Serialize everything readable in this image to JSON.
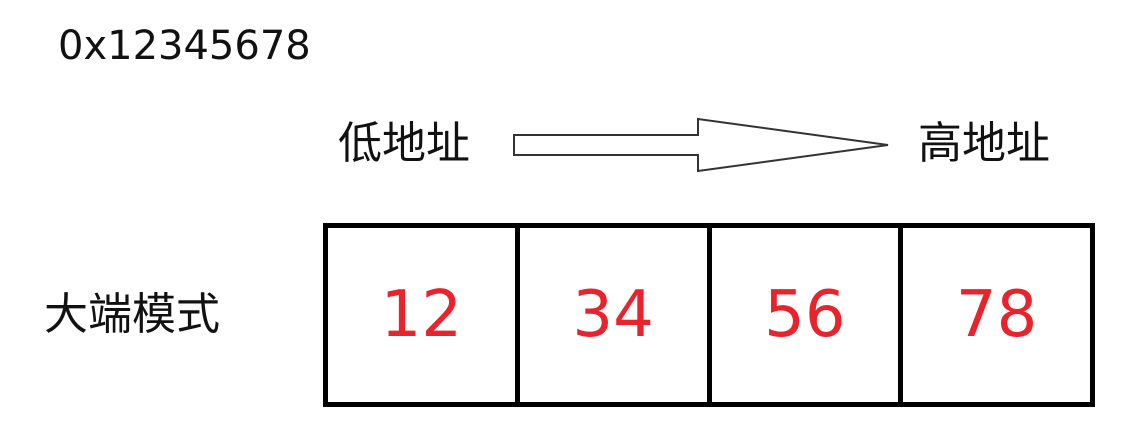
{
  "value": "0x12345678",
  "low_address_label": "低地址",
  "high_address_label": "高地址",
  "arrow_icon": "right-arrow-icon",
  "mode_label": "大端模式",
  "bytes": [
    "12",
    "34",
    "56",
    "78"
  ],
  "colors": {
    "byte_text": "#e8232b",
    "border": "#000000",
    "text": "#111111"
  }
}
